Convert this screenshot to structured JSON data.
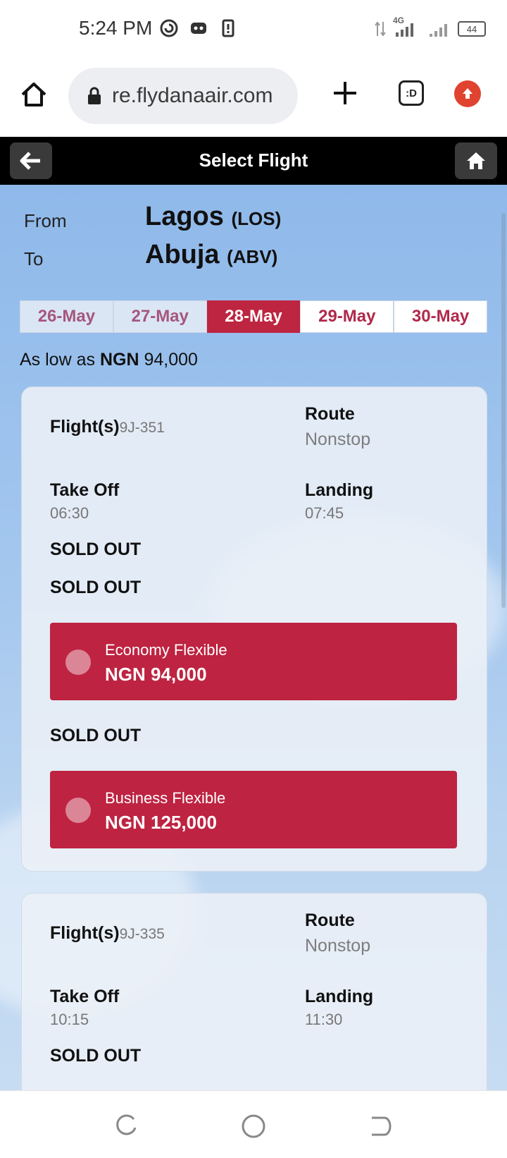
{
  "status": {
    "time": "5:24 PM",
    "network": "4G",
    "battery": "44"
  },
  "browser": {
    "url": "re.flydanaair.com"
  },
  "header": {
    "title": "Select Flight"
  },
  "route": {
    "from_label": "From",
    "from_city": "Lagos",
    "from_code": "(LOS)",
    "to_label": "To",
    "to_city": "Abuja",
    "to_code": "(ABV)"
  },
  "dates": [
    "26-May",
    "27-May",
    "28-May",
    "29-May",
    "30-May"
  ],
  "selected_date": "28-May",
  "low_price": {
    "prefix": "As low as",
    "currency": "NGN",
    "amount": "94,000"
  },
  "flights": [
    {
      "flight_label": "Flight(s)",
      "flight_no": "9J-351",
      "route_label": "Route",
      "route_value": "Nonstop",
      "takeoff_label": "Take Off",
      "takeoff_time": "06:30",
      "landing_label": "Landing",
      "landing_time": "07:45",
      "sold_out_1": "SOLD OUT",
      "sold_out_2": "SOLD OUT",
      "fare_1": {
        "name": "Economy Flexible",
        "price": "NGN 94,000"
      },
      "sold_out_3": "SOLD OUT",
      "fare_2": {
        "name": "Business Flexible",
        "price": "NGN 125,000"
      }
    },
    {
      "flight_label": "Flight(s)",
      "flight_no": "9J-335",
      "route_label": "Route",
      "route_value": "Nonstop",
      "takeoff_label": "Take Off",
      "takeoff_time": "10:15",
      "landing_label": "Landing",
      "landing_time": "11:30",
      "sold_out_1": "SOLD OUT"
    }
  ],
  "colors": {
    "accent": "#be2341",
    "header": "#000000",
    "sky": "#a2c6ee"
  }
}
